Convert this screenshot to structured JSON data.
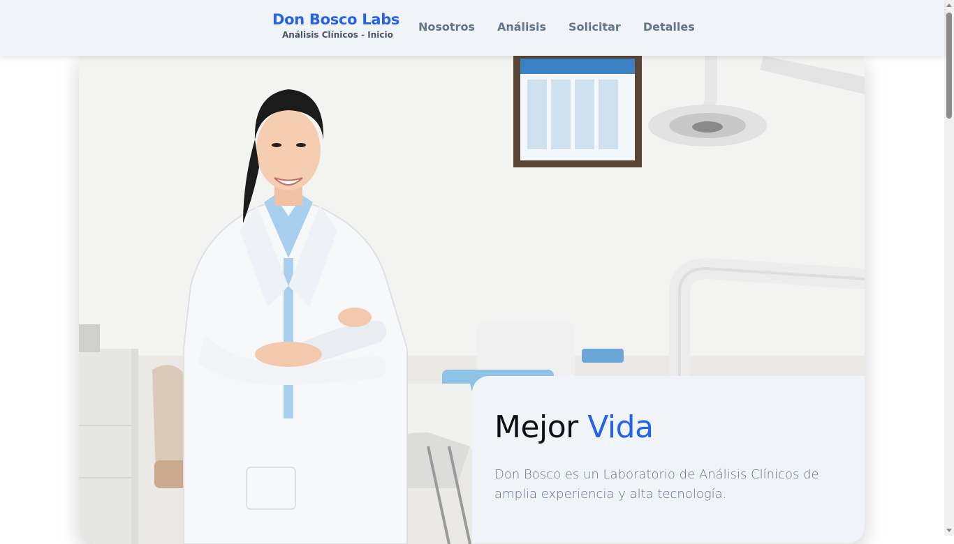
{
  "header": {
    "brand_title": "Don Bosco Labs",
    "brand_subtitle": "Análisis Clínicos - Inicio",
    "nav": [
      {
        "label": "Nosotros"
      },
      {
        "label": "Análisis"
      },
      {
        "label": "Solicitar"
      },
      {
        "label": "Detalles"
      }
    ]
  },
  "hero": {
    "image_icon": "doctor-photo",
    "heading_main": "Mejor",
    "heading_accent": "Vida",
    "description": "Don Bosco es un Laboratorio de Análisis Clínicos de amplia experiencia y alta tecnología."
  },
  "colors": {
    "accent": "#2563eb",
    "nav_background": "#f0f3f8",
    "nav_text": "#64748b"
  }
}
